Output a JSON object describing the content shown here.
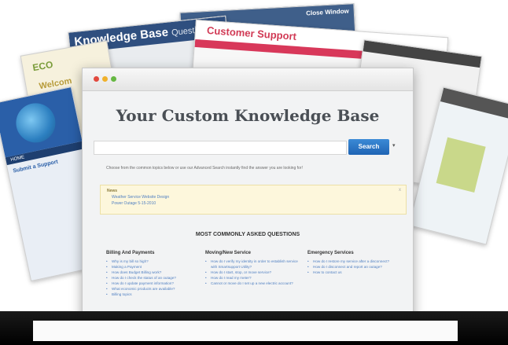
{
  "background_cards": {
    "knowledge_base_title": "Knowledge Base",
    "knowledge_base_sub": "Questi",
    "top_right_text": "Close Window",
    "customer_support_title": "Customer Support",
    "eco_logo": "ECO",
    "eco_welcome": "Welcom",
    "globe_nav": "HOME",
    "globe_label": "Submit a Support"
  },
  "window": {
    "title": "Your Custom Knowledge Base",
    "search_button": "Search",
    "search_placeholder": "",
    "helper_text": "Choose from the common topics below or use our Advanced Search instantly find the answer you are looking for!",
    "news": {
      "title": "News",
      "items": [
        "Weather Service Website Design",
        "Power Outage 5-15-2010"
      ],
      "close": "x"
    },
    "faq_heading": "MOST COMMONLY ASKED QUESTIONS",
    "columns": [
      {
        "title": "Billing And Payments",
        "items": [
          "Why is my bill so high?",
          "Making a Payment",
          "How does Budget Billing work?",
          "How do I check the status of an outage?",
          "How do I update payment information?",
          "What economic products are available?",
          "Billing topics"
        ]
      },
      {
        "title": "Moving/New Service",
        "items": [
          "How do I verify my identity in order to establish service with Smartsupport Utility?",
          "How do I start, stop, or move service?",
          "How do I read my meter?",
          "Cannot or move do I set up a new electric account?"
        ]
      },
      {
        "title": "Emergency Services",
        "items": [
          "How do I restore my service after a disconnect?",
          "How do I disconnect and report an outage?",
          "How to contact us"
        ]
      }
    ]
  },
  "colors": {
    "search_button": "#1f64b4",
    "link": "#4f7fc1",
    "news_bg": "#fdf7dc",
    "customer_support_accent": "#d8385a",
    "kb_header": "#2f4f7f"
  }
}
